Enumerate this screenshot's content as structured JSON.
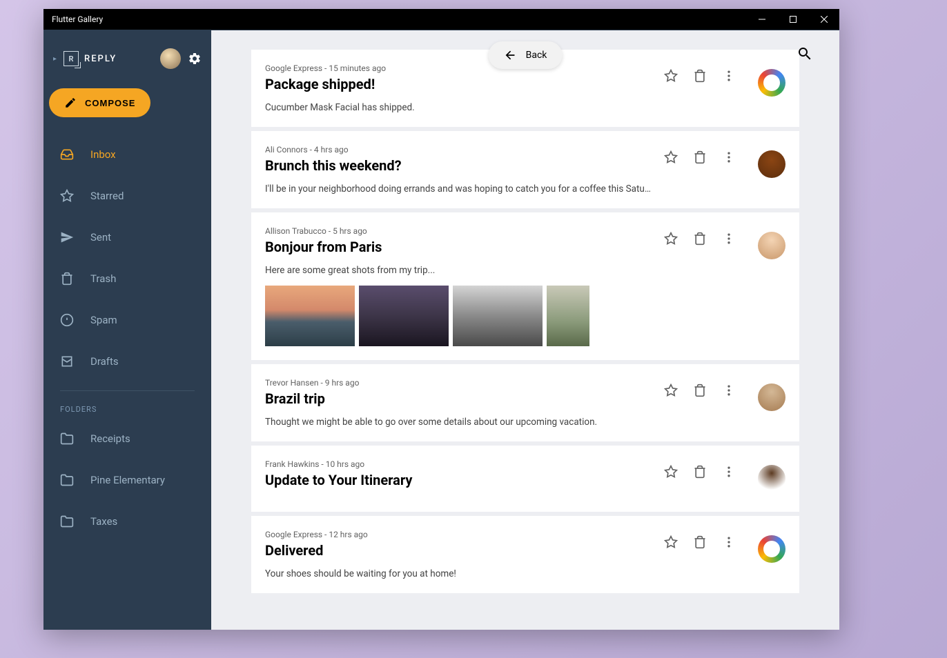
{
  "titlebar": {
    "title": "Flutter Gallery"
  },
  "header": {
    "brand": "REPLY"
  },
  "compose": {
    "label": "COMPOSE"
  },
  "nav": {
    "items": [
      {
        "label": "Inbox",
        "icon": "inbox-icon",
        "active": true
      },
      {
        "label": "Starred",
        "icon": "star-icon",
        "active": false
      },
      {
        "label": "Sent",
        "icon": "send-icon",
        "active": false
      },
      {
        "label": "Trash",
        "icon": "trash-icon",
        "active": false
      },
      {
        "label": "Spam",
        "icon": "spam-icon",
        "active": false
      },
      {
        "label": "Drafts",
        "icon": "drafts-icon",
        "active": false
      }
    ],
    "folders_label": "FOLDERS",
    "folders": [
      {
        "label": "Receipts"
      },
      {
        "label": "Pine Elementary"
      },
      {
        "label": "Taxes"
      }
    ]
  },
  "back": {
    "label": "Back"
  },
  "emails": [
    {
      "sender": "Google Express",
      "time": "15 minutes ago",
      "subject": "Package shipped!",
      "preview": "Cucumber Mask Facial has shipped.",
      "avatar": "express",
      "thumbs": 0
    },
    {
      "sender": "Ali Connors",
      "time": "4 hrs ago",
      "subject": "Brunch this weekend?",
      "preview": "I'll be in your neighborhood doing errands and was hoping to catch you for a coffee this Saturday. If yo...",
      "avatar": "person1",
      "thumbs": 0
    },
    {
      "sender": "Allison Trabucco",
      "time": "5 hrs ago",
      "subject": "Bonjour from Paris",
      "preview": "Here are some great shots from my trip...",
      "avatar": "person2",
      "thumbs": 4
    },
    {
      "sender": "Trevor Hansen",
      "time": "9 hrs ago",
      "subject": "Brazil trip",
      "preview": "Thought we might be able to go over some details about our upcoming vacation.",
      "avatar": "person3",
      "thumbs": 0
    },
    {
      "sender": "Frank Hawkins",
      "time": "10 hrs ago",
      "subject": "Update to Your Itinerary",
      "preview": "",
      "avatar": "person4",
      "thumbs": 0
    },
    {
      "sender": "Google Express",
      "time": "12 hrs ago",
      "subject": "Delivered",
      "preview": "Your shoes should be waiting for you at home!",
      "avatar": "express",
      "thumbs": 0
    }
  ]
}
